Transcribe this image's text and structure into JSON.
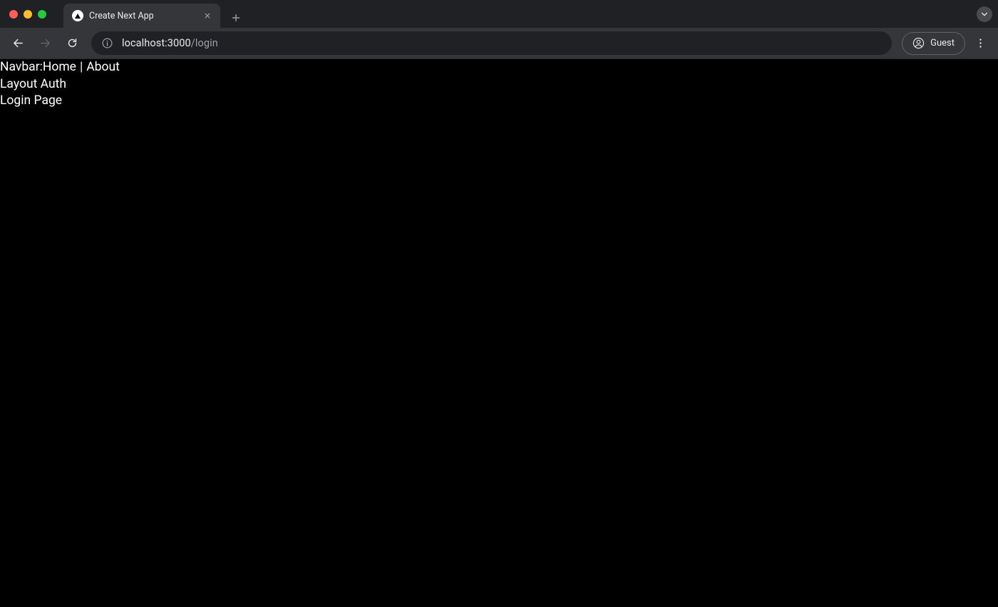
{
  "window": {
    "tab_title": "Create Next App",
    "profile_label": "Guest"
  },
  "omnibox": {
    "host": "localhost:3000",
    "path": "/login"
  },
  "page": {
    "navbar_prefix": "Navbar:",
    "nav_home": "Home",
    "nav_separator": " | ",
    "nav_about": "About",
    "layout_line": "Layout Auth",
    "page_line": "Login Page"
  }
}
